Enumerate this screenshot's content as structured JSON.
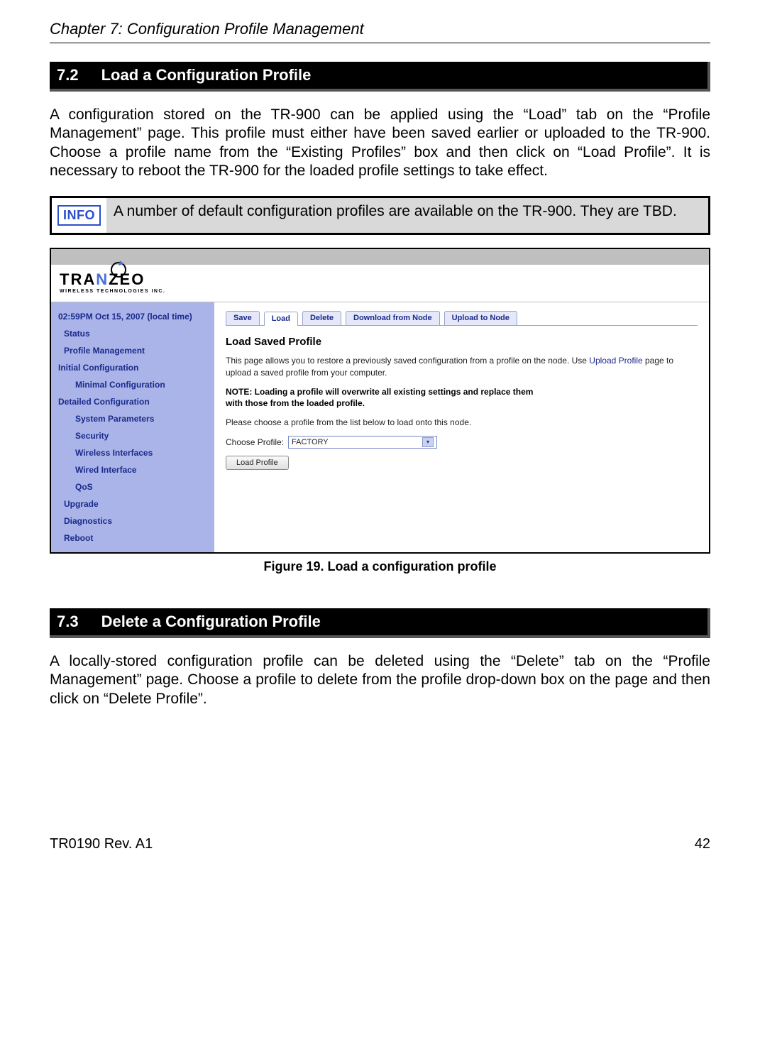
{
  "chapter": "Chapter 7: Configuration Profile Management",
  "section72": {
    "num": "7.2",
    "title": "Load a Configuration Profile",
    "body": "A configuration stored on the TR-900 can be applied using the “Load” tab on the “Profile Management” page. This profile must either have been saved earlier or uploaded to the TR-900. Choose a profile name from the “Existing Profiles” box and then click on “Load Profile”. It is necessary to reboot the TR-900 for the loaded profile settings to take effect."
  },
  "info": {
    "badge": "INFO",
    "text": "A number of default configuration profiles are available on the TR-900. They are TBD."
  },
  "figure": {
    "logo": {
      "p1": "TRA",
      "p2": "N",
      "p3": "ZEO",
      "sub": "WIRELESS  TECHNOLOGIES INC."
    },
    "sidebar": {
      "time": "02:59PM Oct 15, 2007 (local time)",
      "items": [
        {
          "label": "Status",
          "level": 1
        },
        {
          "label": "Profile Management",
          "level": 1
        },
        {
          "label": "Initial Configuration",
          "level": 0
        },
        {
          "label": "Minimal Configuration",
          "level": 2
        },
        {
          "label": "Detailed Configuration",
          "level": 0
        },
        {
          "label": "System Parameters",
          "level": 2
        },
        {
          "label": "Security",
          "level": 2
        },
        {
          "label": "Wireless Interfaces",
          "level": 2
        },
        {
          "label": "Wired Interface",
          "level": 2
        },
        {
          "label": "QoS",
          "level": 2
        },
        {
          "label": "Upgrade",
          "level": 1
        },
        {
          "label": "Diagnostics",
          "level": 1
        },
        {
          "label": "Reboot",
          "level": 1
        }
      ]
    },
    "tabs": [
      "Save",
      "Load",
      "Delete",
      "Download from Node",
      "Upload to Node"
    ],
    "active_tab": 1,
    "heading": "Load Saved Profile",
    "p1a": "This page allows you to restore a previously saved configuration from a profile on the node. Use ",
    "p1link": "Upload Profile",
    "p1b": " page to upload a saved profile from your computer.",
    "note": "NOTE: Loading a profile will overwrite all existing settings and replace them with those from the loaded profile.",
    "p2": "Please choose a profile from the list below to load onto this node.",
    "choose_label": "Choose Profile:",
    "choose_value": "FACTORY",
    "button": "Load Profile",
    "caption": "Figure 19. Load a configuration profile"
  },
  "section73": {
    "num": "7.3",
    "title": "Delete a Configuration Profile",
    "body": "A locally-stored configuration profile can be deleted using the “Delete” tab on the “Profile Management” page. Choose a profile to delete from the profile drop-down box on the page and then click on “Delete Profile”."
  },
  "footer": {
    "left": "TR0190 Rev. A1",
    "right": "42"
  }
}
